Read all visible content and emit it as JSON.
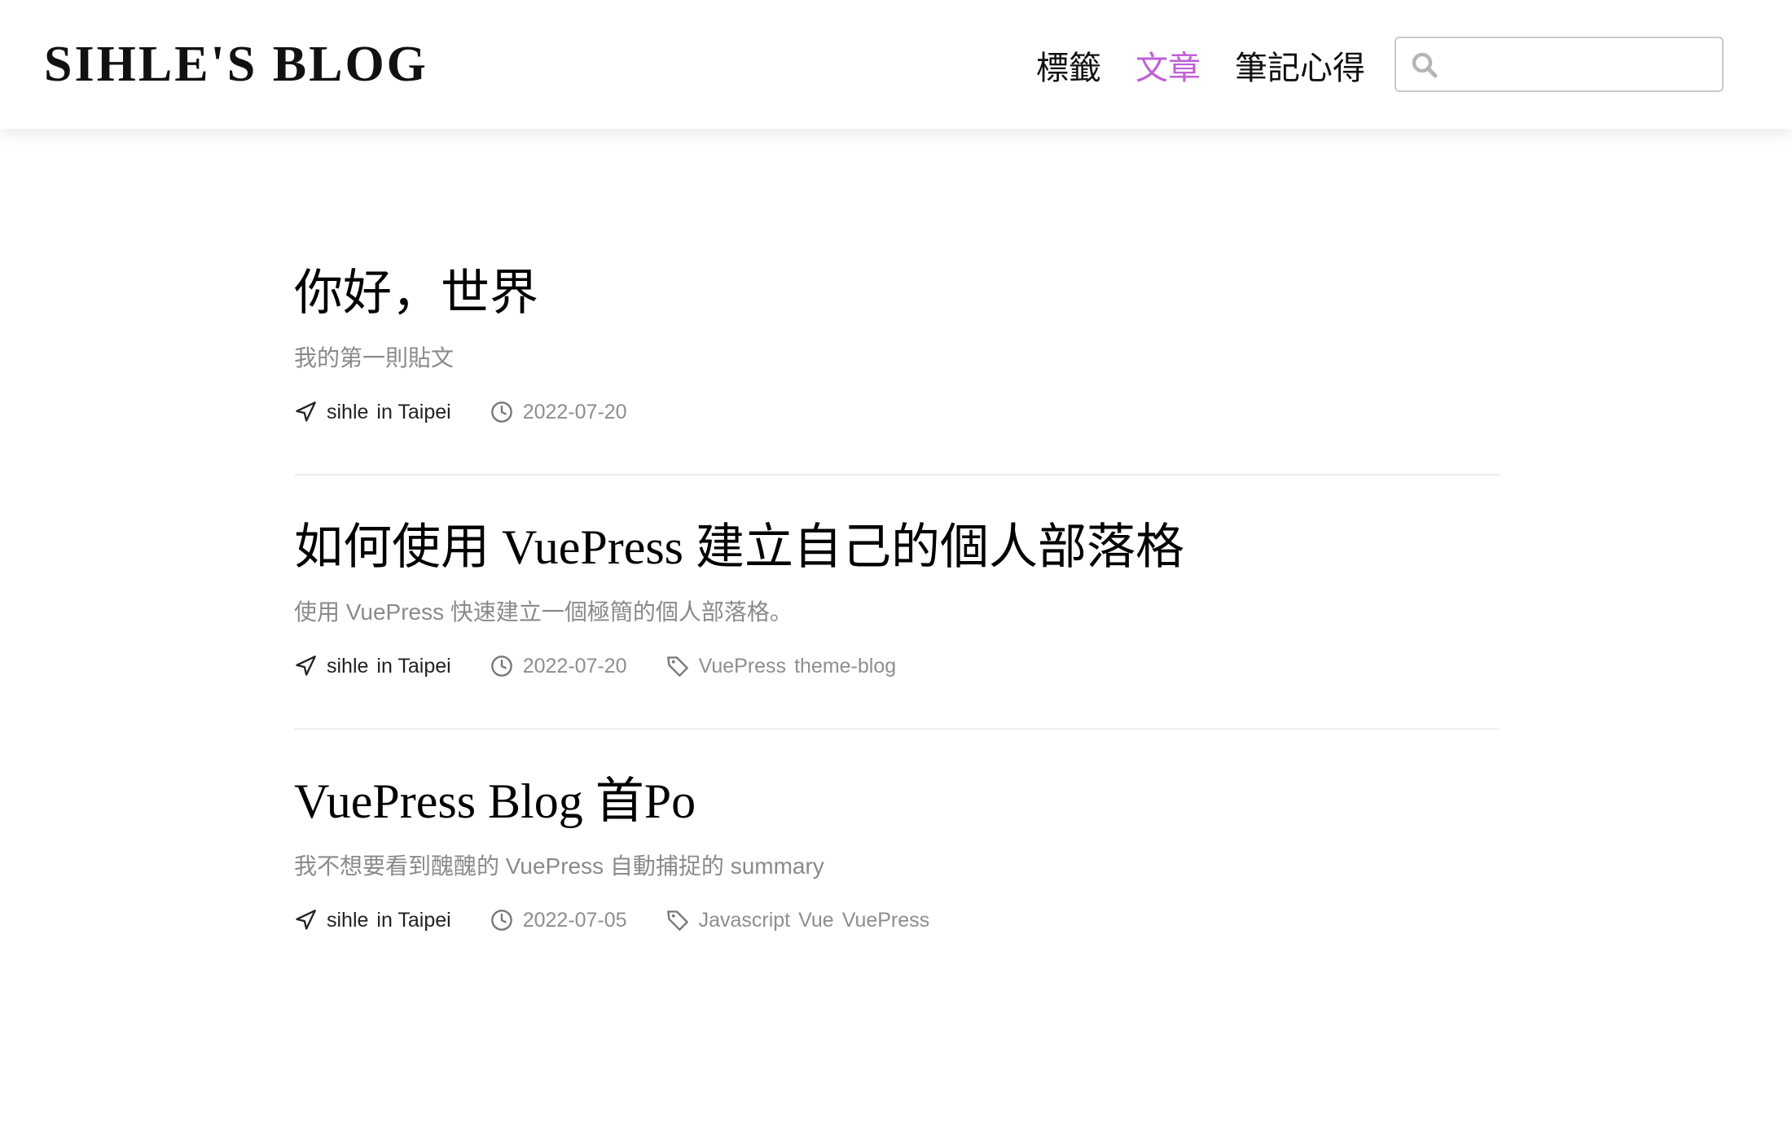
{
  "site": {
    "brand": "SIHLE'S BLOG"
  },
  "nav": [
    {
      "label": "標籤",
      "active": false
    },
    {
      "label": "文章",
      "active": true
    },
    {
      "label": "筆記心得",
      "active": false
    }
  ],
  "search": {
    "value": "",
    "placeholder": ""
  },
  "colors": {
    "accent": "#c05fd6",
    "muted": "#8a8a8a",
    "divider": "#eeeeee"
  },
  "posts": [
    {
      "title": "你好，世界",
      "summary": "我的第一則貼文",
      "author": "sihle",
      "location": "in Taipei",
      "date": "2022-07-20",
      "tags": []
    },
    {
      "title": "如何使用 VuePress 建立自己的個人部落格",
      "summary": "使用 VuePress 快速建立一個極簡的個人部落格。",
      "author": "sihle",
      "location": "in Taipei",
      "date": "2022-07-20",
      "tags": [
        "VuePress",
        "theme-blog"
      ]
    },
    {
      "title": "VuePress Blog 首Po",
      "summary": "我不想要看到醜醜的 VuePress 自動捕捉的 summary",
      "author": "sihle",
      "location": "in Taipei",
      "date": "2022-07-05",
      "tags": [
        "Javascript",
        "Vue",
        "VuePress"
      ]
    }
  ]
}
